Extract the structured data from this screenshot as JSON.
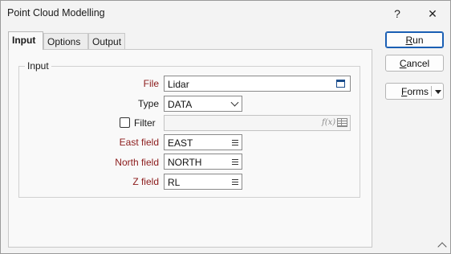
{
  "window": {
    "title": "Point Cloud Modelling",
    "help_label": "?",
    "close_label": "✕"
  },
  "tabs": [
    {
      "label": "Input",
      "active": true
    },
    {
      "label": "Options",
      "active": false
    },
    {
      "label": "Output",
      "active": false
    }
  ],
  "input_group": {
    "legend": "Input",
    "file": {
      "label": "File",
      "value": "Lidar",
      "required": true
    },
    "type": {
      "label": "Type",
      "value": "DATA",
      "required": false
    },
    "filter": {
      "label": "Filter",
      "checked": false,
      "value": "",
      "fx_label": "f(x)"
    },
    "east_field": {
      "label": "East field",
      "value": "EAST",
      "required": true
    },
    "north_field": {
      "label": "North field",
      "value": "NORTH",
      "required": true
    },
    "z_field": {
      "label": "Z field",
      "value": "RL",
      "required": true
    }
  },
  "buttons": {
    "run": {
      "mnemonic": "R",
      "rest": "un"
    },
    "cancel": {
      "mnemonic": "C",
      "rest": "ancel"
    },
    "forms": {
      "mnemonic": "F",
      "rest": "orms"
    }
  },
  "colors": {
    "required_label": "#8b1a1a",
    "primary_border": "#1a5fb4",
    "calendar_icon": "#1a4c8c"
  }
}
